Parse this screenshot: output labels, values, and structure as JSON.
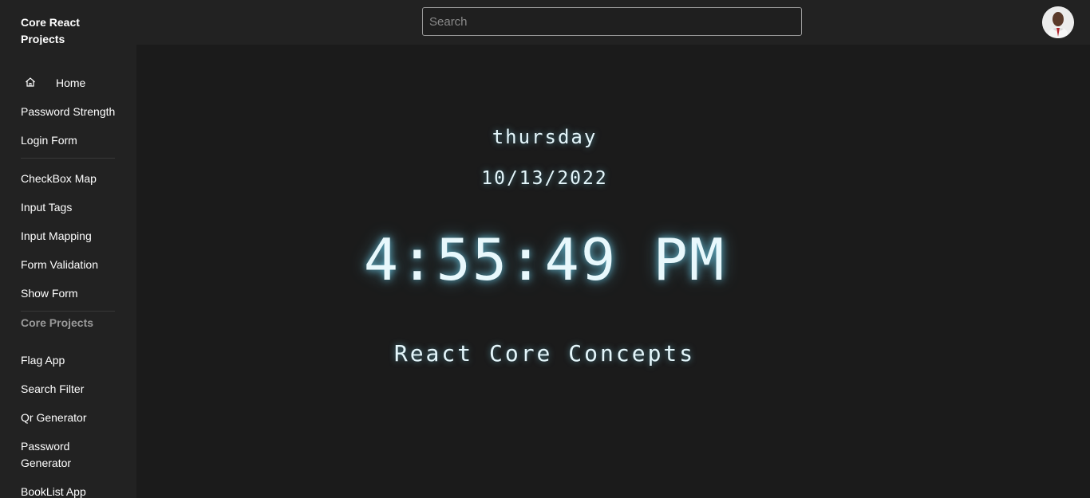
{
  "header": {
    "brand": "Core React Projects",
    "search_placeholder": "Search",
    "search_value": ""
  },
  "sidebar": {
    "items": [
      {
        "label": "Home",
        "icon": "home-icon"
      },
      {
        "label": "Password Strength"
      },
      {
        "label": "Login Form"
      },
      {
        "label": "CheckBox Map"
      },
      {
        "label": "Input Tags"
      },
      {
        "label": "Input Mapping"
      },
      {
        "label": "Form Validation"
      },
      {
        "label": "Show Form"
      },
      {
        "label": "Core Projects"
      },
      {
        "label": "Flag App"
      },
      {
        "label": "Search Filter"
      },
      {
        "label": "Qr Generator"
      },
      {
        "label": "Password Generator"
      },
      {
        "label": "BookList App"
      }
    ]
  },
  "clock": {
    "day": "thursday",
    "date": "10/13/2022",
    "time": "4:55:49 PM",
    "tagline": "React Core Concepts"
  },
  "colors": {
    "background": "#1b1b1b",
    "panel": "#222222",
    "glow_text": "#e4f6fb",
    "glow": "#6ed2f0"
  }
}
